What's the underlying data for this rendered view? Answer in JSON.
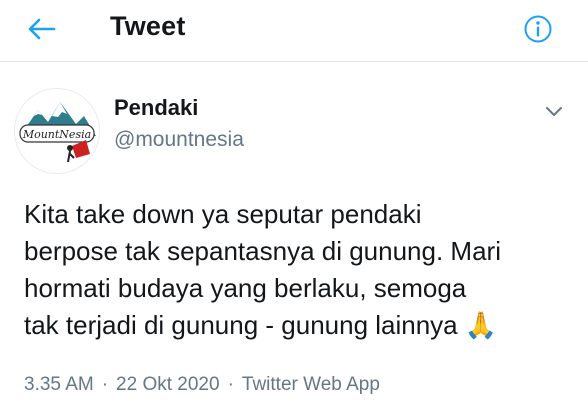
{
  "header": {
    "title": "Tweet",
    "back_icon": "arrow-left-icon",
    "info_icon": "info-circle-icon",
    "accent_color": "#1da1f2"
  },
  "author": {
    "display_name": "Pendaki",
    "handle": "@mountnesia",
    "avatar_text": "MountNesia",
    "menu_icon": "chevron-down-icon"
  },
  "tweet": {
    "lines": [
      "Kita take down ya seputar pendaki",
      "berpose tak sepantasnya di gunung. Mari",
      "hormati budaya yang berlaku, semoga",
      "tak terjadi di gunung - gunung lainnya"
    ],
    "emoji": "🙏",
    "emoji_icon": "folded-hands-icon"
  },
  "meta": {
    "time": "3.35 AM",
    "separator": "·",
    "date": "22 Okt 2020",
    "source": "Twitter Web App"
  }
}
